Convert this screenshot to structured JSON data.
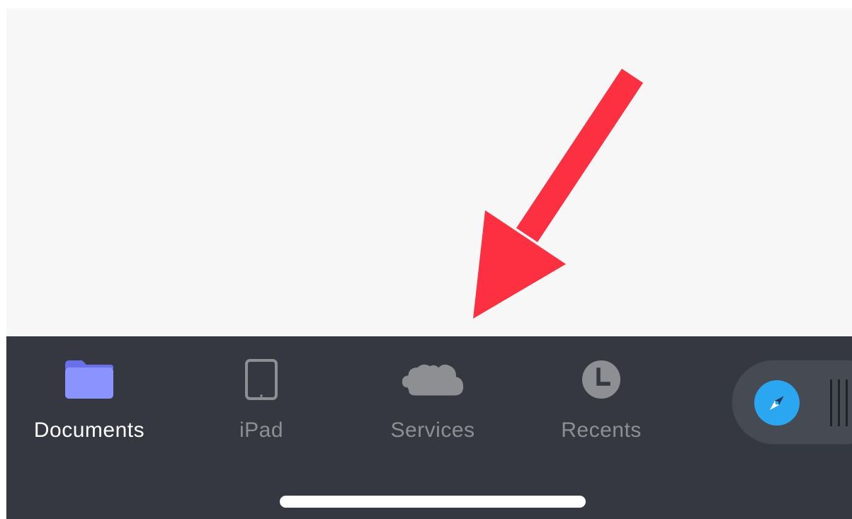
{
  "tab_bar": {
    "background": "#353840",
    "tabs": [
      {
        "id": "documents",
        "label": "Documents",
        "icon": "folder-icon",
        "active": true,
        "icon_color": "#8b93ff"
      },
      {
        "id": "ipad",
        "label": "iPad",
        "icon": "ipad-icon",
        "active": false,
        "icon_color": "#8e8f93"
      },
      {
        "id": "services",
        "label": "Services",
        "icon": "cloud-icon",
        "active": false,
        "icon_color": "#8e8f93"
      },
      {
        "id": "recents",
        "label": "Recents",
        "icon": "clock-icon",
        "active": false,
        "icon_color": "#8e8f93"
      }
    ]
  },
  "browser_button": {
    "icon": "compass-icon",
    "color": "#2aa7f0"
  },
  "annotation": {
    "type": "arrow",
    "color": "#fc3040"
  },
  "colors": {
    "content_background": "#f7f7f8",
    "active_label": "#ffffff",
    "inactive_label": "#8e8f93"
  }
}
